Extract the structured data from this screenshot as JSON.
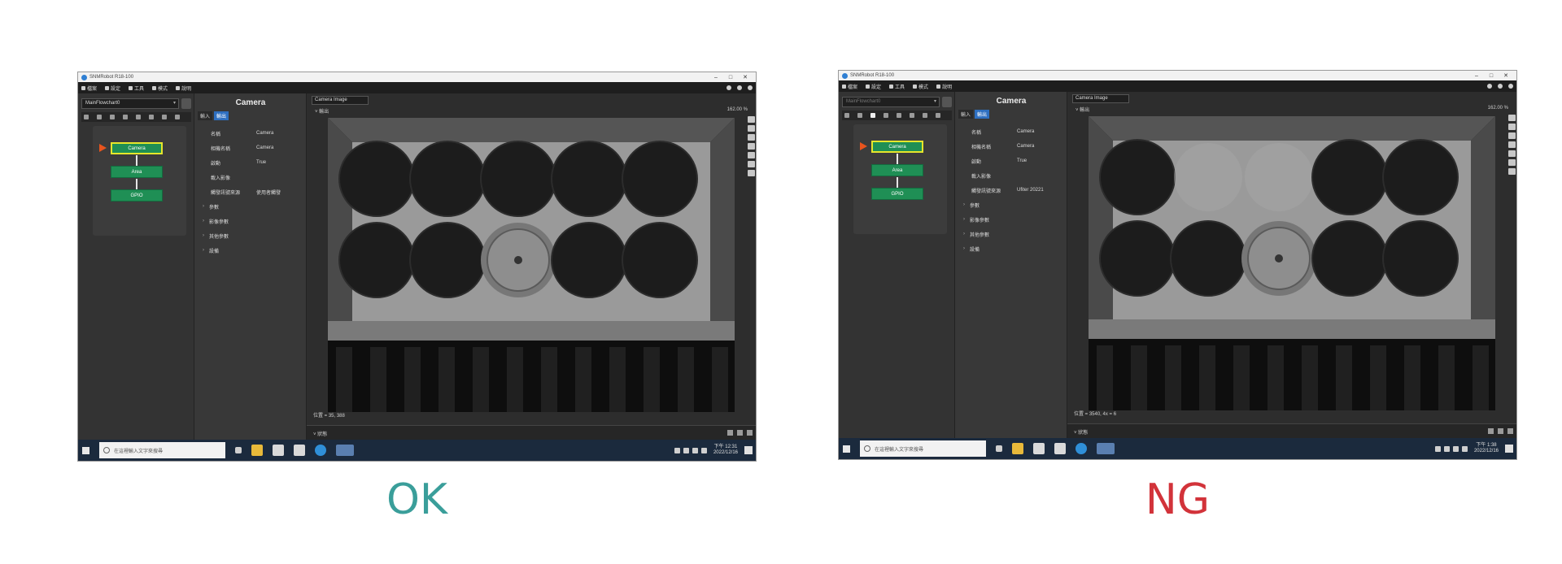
{
  "screens": [
    {
      "verdict": "OK",
      "window_title": "SNMRobot R18-100",
      "menu": [
        "檔案",
        "設定",
        "工具",
        "模式",
        "說明"
      ],
      "flow_selector": "MainFlowchart0",
      "nodes": [
        "Camera",
        "Area",
        "GPIO"
      ],
      "prop_title": "Camera",
      "prop_tabs": [
        "輸入",
        "輸出"
      ],
      "props": [
        {
          "key": "名稱",
          "value": "Camera"
        },
        {
          "key": "相機名稱",
          "value": "Camera"
        },
        {
          "key": "啟動",
          "value": "True"
        },
        {
          "key": "載入影像",
          "value": ""
        },
        {
          "key": "觸發訊號來源",
          "value": "使用者觸發"
        }
      ],
      "groups": [
        "參數",
        "影像參數",
        "其他參數",
        "設備"
      ],
      "image_selector": "Camera Image",
      "image_sub": "˅ 輸出",
      "zoom": "162.00 %",
      "coords": "位置 = 35, 388",
      "status_label": "˅ 狀態",
      "clock_time": "下午 12:31",
      "clock_date": "2022/12/16",
      "search_placeholder": "在這裡輸入文字來搜尋",
      "scene": "ok"
    },
    {
      "verdict": "NG",
      "window_title": "SNMRobot R18-100",
      "menu": [
        "檔案",
        "設定",
        "工具",
        "模式",
        "說明"
      ],
      "flow_selector": "MainFlowchart0",
      "nodes": [
        "Camera",
        "Area",
        "GPIO"
      ],
      "prop_title": "Camera",
      "prop_tabs": [
        "輸入",
        "輸出"
      ],
      "props": [
        {
          "key": "名稱",
          "value": "Camera"
        },
        {
          "key": "相機名稱",
          "value": "Camera"
        },
        {
          "key": "啟動",
          "value": "True"
        },
        {
          "key": "載入影像",
          "value": ""
        },
        {
          "key": "觸發訊號來源",
          "value": "Ufiter 20221"
        }
      ],
      "groups": [
        "參數",
        "影像參數",
        "其他參數",
        "設備"
      ],
      "image_selector": "Camera Image",
      "image_sub": "˅ 輸出",
      "zoom": "162.00 %",
      "coords": "位置 = 3540, 4x = 6",
      "status_label": "˅ 狀態",
      "clock_time": "下午 1:38",
      "clock_date": "2022/12/16",
      "search_placeholder": "在這裡輸入文字來搜尋",
      "scene": "ng"
    }
  ],
  "colors": {
    "ok": "#3a9e9a",
    "ng": "#d2333a",
    "node_fill": "#1f8f55",
    "active_border": "#e6e62a",
    "run_arrow": "#e8541d"
  },
  "icons": [
    "windows-start-icon",
    "search-icon",
    "task-view-icon",
    "file-explorer-icon",
    "excel-icon",
    "edge-icon",
    "app-icon"
  ]
}
